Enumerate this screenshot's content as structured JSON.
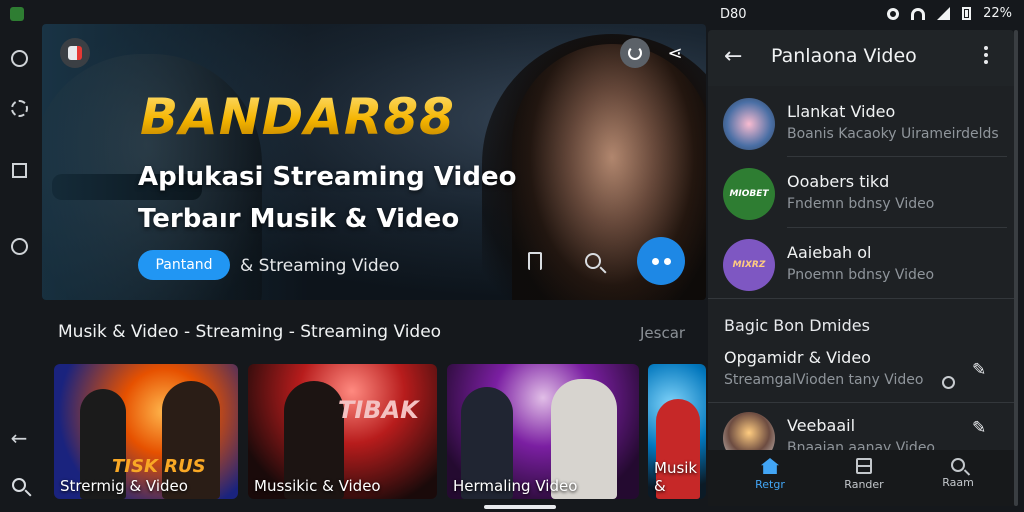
{
  "status_bar": {
    "left_text": "D80",
    "battery": "22%",
    "icons": [
      "app-icon",
      "gear-icon",
      "wifi-icon",
      "signal-icon",
      "battery-icon"
    ]
  },
  "hero": {
    "brand": "BANDAR88",
    "headline_line1": "Aplukasi Streaming Video",
    "headline_line2": "Terbaır Musik & Video",
    "pill_label": "Pantand",
    "subtitle": "& Streaming Video"
  },
  "section": {
    "title": "Musik & Video - Streaming - Streaming Video",
    "more": "Jescar",
    "thumbs": [
      {
        "caption": "Strermig & Video",
        "overlay": "TISK RUS"
      },
      {
        "caption": "Mussikic & Video",
        "overlay": "TIBAK"
      },
      {
        "caption": "Hermaling Video",
        "overlay": ""
      },
      {
        "caption": "Musik &",
        "overlay": ""
      }
    ]
  },
  "panel": {
    "title": "Panlaona Video",
    "rows": [
      {
        "title": "Llankat Video",
        "sub": "Boanis Kacaoky Uirameirdelds"
      },
      {
        "title": "Ooabers tikd",
        "sub": "Fndemn bdnsy Video"
      },
      {
        "title": "Aaiebah ol",
        "sub": "Pnoemn bdnsy Video"
      }
    ],
    "sub_header": "Bagic Bon Dmides",
    "rows2": [
      {
        "title": "Opgamidr & Video",
        "sub": "StreamgalVioden tany Video"
      },
      {
        "title": "Veebaail",
        "sub": "Bnaaian aanay Video"
      }
    ],
    "tabs": [
      {
        "label": "Retgr",
        "icon": "home-icon",
        "active": true
      },
      {
        "label": "Rander",
        "icon": "box-icon",
        "active": false
      },
      {
        "label": "Raam",
        "icon": "search-icon",
        "active": false
      }
    ]
  },
  "colors": {
    "accent": "#2196f3",
    "brand_gold": "#f4b400",
    "background": "#15181c"
  }
}
